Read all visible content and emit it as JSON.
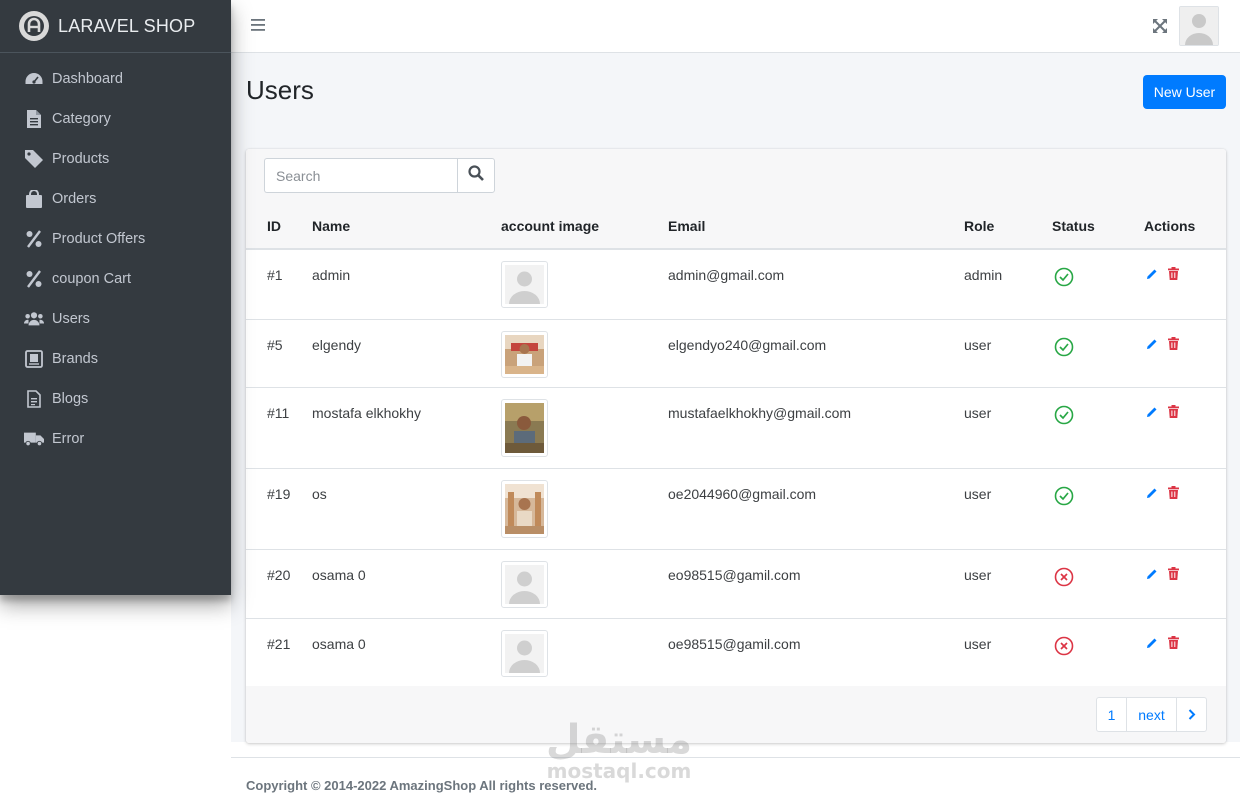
{
  "brand": {
    "name": "LARAVEL SHOP"
  },
  "sidebar": {
    "items": [
      {
        "label": "Dashboard",
        "icon": "tachometer-icon"
      },
      {
        "label": "Category",
        "icon": "file-icon"
      },
      {
        "label": "Products",
        "icon": "tag-icon"
      },
      {
        "label": "Orders",
        "icon": "shopping-bag-icon"
      },
      {
        "label": "Product Offers",
        "icon": "percent-icon"
      },
      {
        "label": "coupon Cart",
        "icon": "percent-icon"
      },
      {
        "label": "Users",
        "icon": "users-icon"
      },
      {
        "label": "Brands",
        "icon": "book-icon"
      },
      {
        "label": "Blogs",
        "icon": "file-alt-icon"
      },
      {
        "label": "Error",
        "icon": "truck-icon"
      }
    ]
  },
  "header": {
    "menu_icon": "hamburger-icon",
    "fullscreen_icon": "expand-icon",
    "avatar_icon": "user-avatar"
  },
  "page": {
    "title": "Users",
    "new_button": "New User"
  },
  "search": {
    "placeholder": "Search",
    "icon": "search-icon"
  },
  "table": {
    "columns": [
      "ID",
      "Name",
      "account image",
      "Email",
      "Role",
      "Status",
      "Actions"
    ],
    "rows": [
      {
        "id": "#1",
        "name": "admin",
        "image": "default-avatar",
        "email": "admin@gmail.com",
        "role": "admin",
        "status": "active"
      },
      {
        "id": "#5",
        "name": "elgendy",
        "image": "photo",
        "email": "elgendyo240@gmail.com",
        "role": "user",
        "status": "active"
      },
      {
        "id": "#11",
        "name": "mostafa elkhokhy",
        "image": "photo",
        "email": "mustafaelkhokhy@gmail.com",
        "role": "user",
        "status": "active"
      },
      {
        "id": "#19",
        "name": "os",
        "image": "photo",
        "email": "oe2044960@gmail.com",
        "role": "user",
        "status": "active"
      },
      {
        "id": "#20",
        "name": "osama 0",
        "image": "default-avatar",
        "email": "eo98515@gamil.com",
        "role": "user",
        "status": "inactive"
      },
      {
        "id": "#21",
        "name": "osama 0",
        "image": "default-avatar",
        "email": "oe98515@gamil.com",
        "role": "user",
        "status": "inactive"
      }
    ]
  },
  "pagination": {
    "page": "1",
    "next": "next"
  },
  "footer": {
    "copyright": "Copyright © 2014-2022 AmazingShop All rights reserved."
  },
  "watermark": {
    "arabic": "مستقل",
    "latin": "mostaql.com"
  },
  "colors": {
    "sidebar": "#343a40",
    "primary": "#007bff",
    "success": "#28a745",
    "danger": "#dc3545"
  }
}
